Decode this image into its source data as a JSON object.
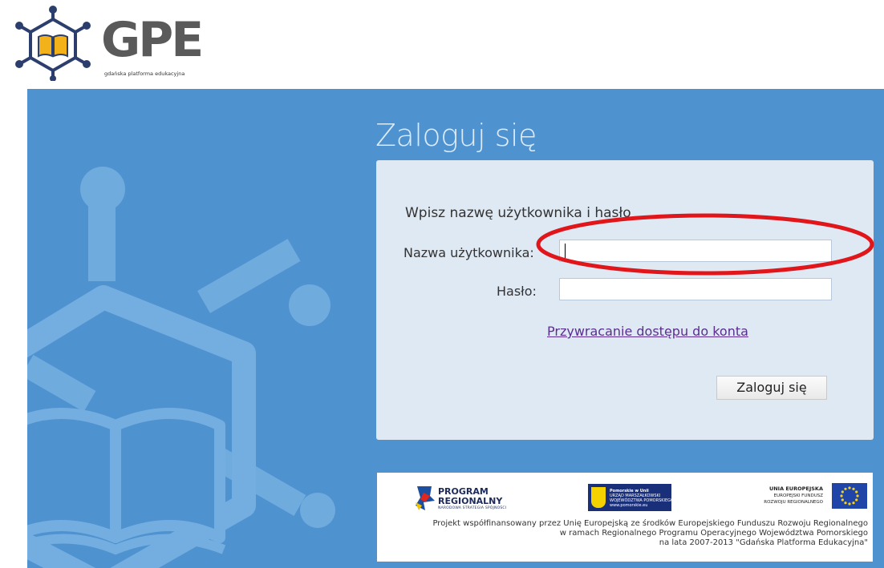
{
  "header": {
    "logo_text": "GPE",
    "logo_subtitle": "gdańska platforma edukacyjna"
  },
  "login": {
    "title": "Zaloguj się",
    "prompt": "Wpisz nazwę użytkownika i hasło",
    "username_label": "Nazwa użytkownika:",
    "username_value": "",
    "password_label": "Hasło:",
    "password_value": "",
    "recover_link": "Przywracanie dostępu do konta",
    "submit_label": "Zaloguj się"
  },
  "funding": {
    "program_title_1": "PROGRAM",
    "program_title_2": "REGIONALNY",
    "program_subtitle": "NARODOWA STRATEGIA SPÓJNOŚCI",
    "pomorskie_1": "Pomorskie w Unii",
    "pomorskie_2": "URZĄD MARSZAŁKOWSKI",
    "pomorskie_3": "WOJEWÓDZTWA POMORSKIEGO",
    "pomorskie_4": "www.pomorskie.eu",
    "eu_title": "UNIA EUROPEJSKA",
    "eu_line1": "EUROPEJSKI FUNDUSZ",
    "eu_line2": "ROZWOJU REGIONALNEGO",
    "note_line1": "Projekt współfinansowany przez Unię Europejską ze środków Europejskiego Funduszu Rozwoju Regionalnego",
    "note_line2": "w ramach Regionalnego Programu Operacyjnego Województwa Pomorskiego",
    "note_line3": "na lata 2007-2013 \"Gdańska Platforma Edukacyjna\""
  },
  "colors": {
    "band": "#4f92d0",
    "panel": "#dfe9f4",
    "annotation": "#e0161b",
    "link": "#5b2d91"
  }
}
